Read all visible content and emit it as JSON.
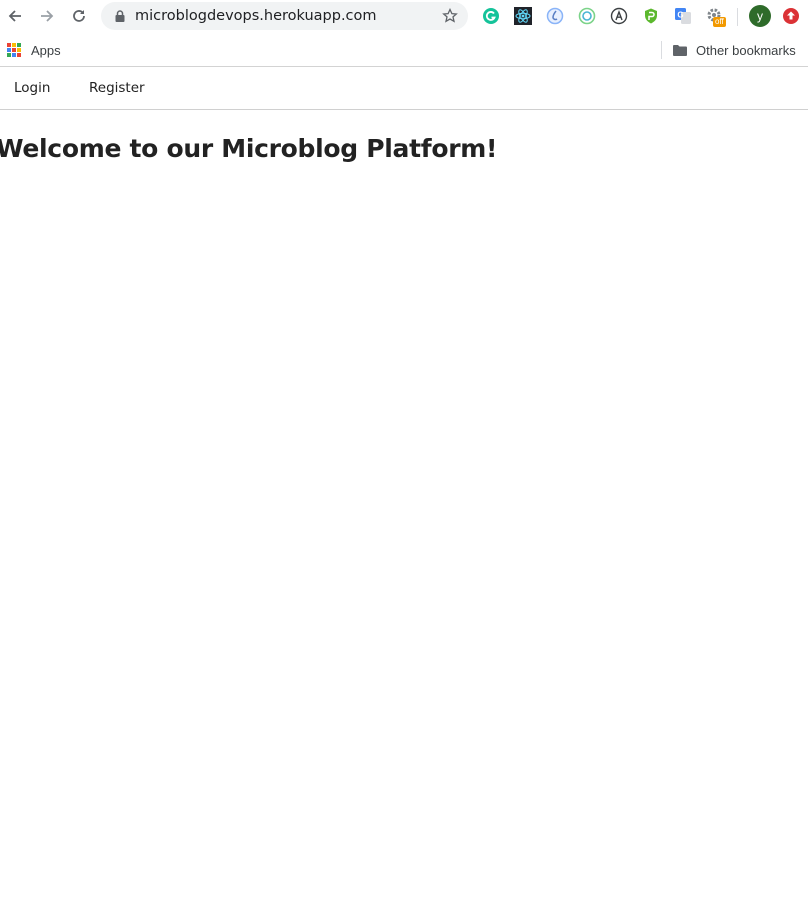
{
  "browser": {
    "url": "microblogdevops.herokuapp.com",
    "avatar_letter": "y",
    "extension_badge": "off",
    "bookmarks": {
      "apps_label": "Apps",
      "other_label": "Other bookmarks"
    }
  },
  "site": {
    "nav": {
      "login": "Login",
      "register": "Register"
    },
    "heading": "Welcome to our Microblog Platform!"
  },
  "colors": {
    "grammarly": "#15c39a",
    "react": "#61dafb",
    "avatar": "#2e6b2a",
    "vpn": "#5cb82e",
    "translate": "#4285f4",
    "badge": "#f29900",
    "upload": "#db3236"
  }
}
